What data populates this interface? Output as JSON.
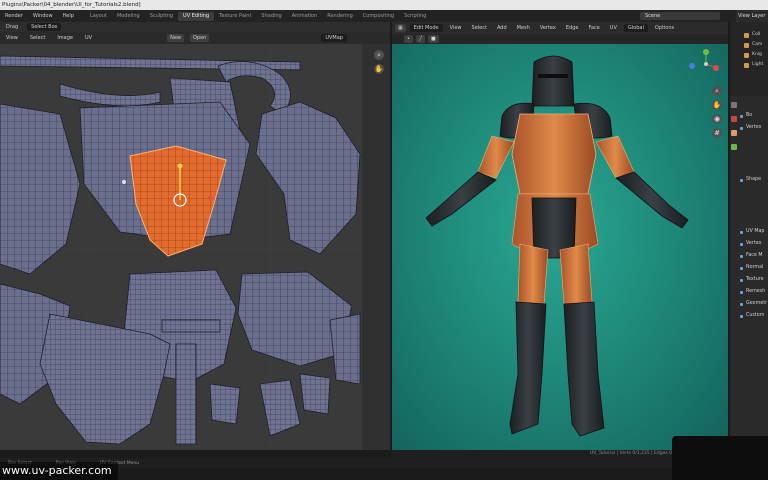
{
  "window": {
    "title": "Plugins\\Packer\\04_blender\\UI_for_Tutorials2.blend]"
  },
  "menubar": {
    "menus": [
      "Render",
      "Window",
      "Help"
    ],
    "workspaces": [
      "Layout",
      "Modeling",
      "Sculpting",
      "UV Editing",
      "Texture Paint",
      "Shading",
      "Animation",
      "Rendering",
      "Compositing",
      "Scripting"
    ],
    "active_workspace": "UV Editing",
    "scene_label": "Scene",
    "view_layer_label": "View Layer"
  },
  "uv_editor": {
    "header_top": {
      "mode_label": "Drag",
      "select_box": "Select Box"
    },
    "header": {
      "menus": [
        "View",
        "Select",
        "Image",
        "UV"
      ],
      "new_button": "New",
      "open_button": "Open",
      "uvmap_field": "UVMap"
    }
  },
  "viewport": {
    "header": {
      "mode": "Edit Mode",
      "menus": [
        "View",
        "Select",
        "Add",
        "Mesh",
        "Vertex",
        "Edge",
        "Face",
        "UV"
      ],
      "orientation": "Global",
      "options": "Options"
    },
    "footer_text": "UV_Tutorial | Verts 0/1,235 | Edges 0/2,456 | Faces 0/1,221"
  },
  "outliner": {
    "items": [
      "Coll",
      "Cam",
      "Knig",
      "Light"
    ]
  },
  "properties": {
    "rows": [
      "Bo",
      "Vertex",
      "Shape",
      "UV Map",
      "Vertex",
      "Face M",
      "Normal",
      "Texture",
      "Remesh",
      "Geometr",
      "Custom"
    ]
  },
  "statusbar": {
    "items": [
      "Box Select",
      "Pan View",
      "UV Context Menu"
    ]
  },
  "watermark": "www.uv-packer.com",
  "colors": {
    "uv_background": "#3a3a3a",
    "uv_island": "#6b6f8e",
    "uv_selected": "#e46b2e",
    "viewport_center": "#2aa894",
    "armor_selected": "#c96a35",
    "armor_dark": "#2a2e31"
  }
}
